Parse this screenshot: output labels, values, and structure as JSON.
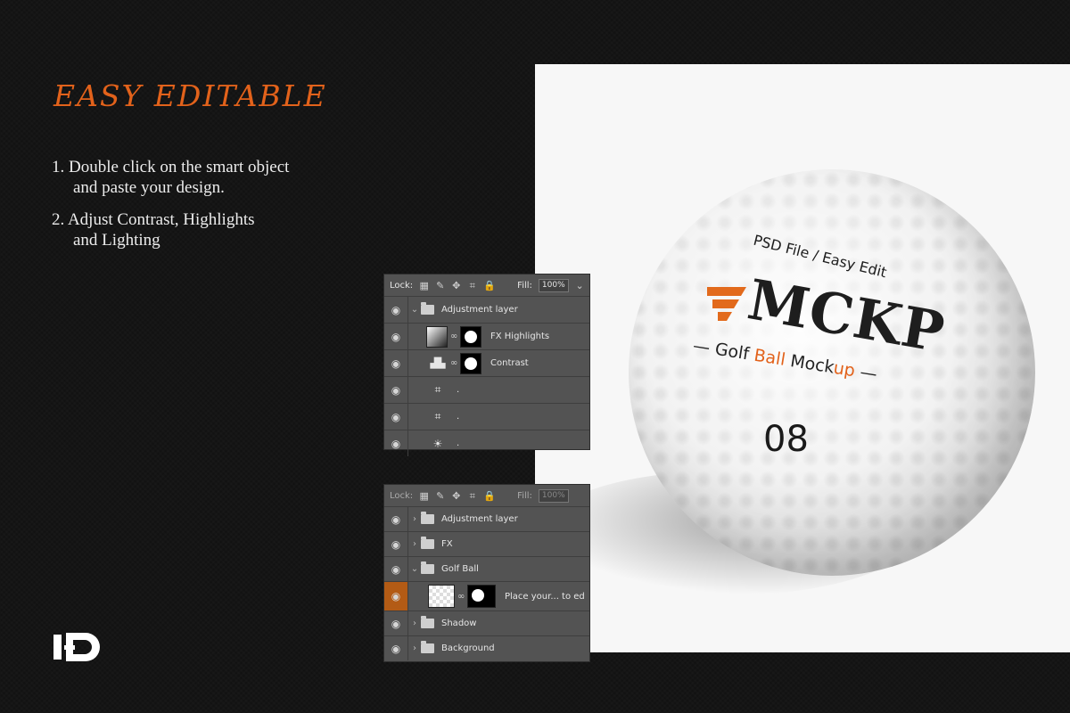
{
  "headline": "EASY EDITABLE",
  "steps": [
    {
      "line1": "1. Double click on the smart object",
      "line2": "and paste your design."
    },
    {
      "line1": "2. Adjust Contrast, Highlights",
      "line2": "and Lighting"
    }
  ],
  "ball": {
    "subtitle": "PSD File / Easy Edit",
    "brand": "MCKP",
    "tag_part1": "Golf ",
    "tag_part2": "Ball",
    "tag_part3": " Mock",
    "tag_part4": "up",
    "number": "08"
  },
  "panel1": {
    "lock_label": "Lock:",
    "fill_label": "Fill:",
    "fill_value": "100%",
    "layers": [
      {
        "name": "Adjustment layer"
      },
      {
        "name": "FX Highlights"
      },
      {
        "name": "Contrast"
      },
      {
        "name": "."
      },
      {
        "name": "."
      },
      {
        "name": "."
      }
    ]
  },
  "panel2": {
    "lock_label": "Lock:",
    "fill_label": "Fill:",
    "fill_value": "100%",
    "layers": [
      {
        "name": "Adjustment layer"
      },
      {
        "name": "FX"
      },
      {
        "name": "Golf Ball"
      },
      {
        "name": "Place your... to ed"
      },
      {
        "name": "Shadow"
      },
      {
        "name": "Background"
      }
    ]
  },
  "colors": {
    "accent": "#e2621b",
    "selected_layer": "#b35b15"
  }
}
